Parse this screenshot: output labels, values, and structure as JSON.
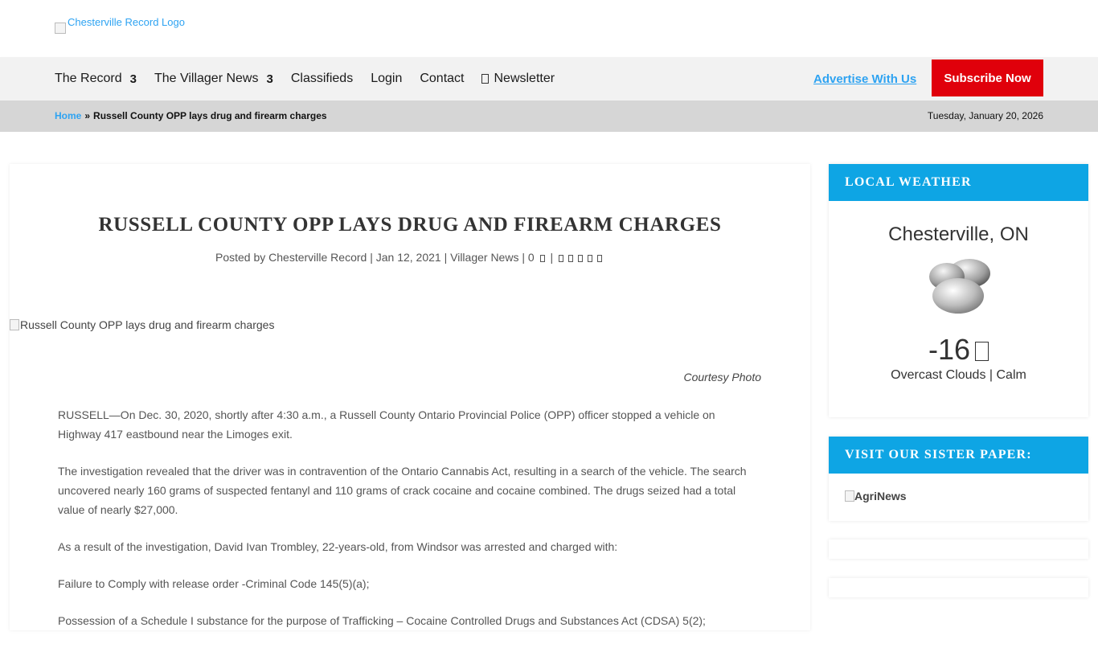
{
  "header": {
    "logo_alt": "Chesterville Record Logo"
  },
  "nav": {
    "items": [
      {
        "label": "The Record",
        "caret": "3"
      },
      {
        "label": "The Villager News",
        "caret": "3"
      },
      {
        "label": "Classifieds"
      },
      {
        "label": "Login"
      },
      {
        "label": "Contact"
      },
      {
        "label": "Newsletter",
        "icon": "envelope-icon"
      }
    ],
    "advertise_label": "Advertise With Us",
    "subscribe_label": "Subscribe Now",
    "subscribe_color": "#e0000b",
    "link_color": "#2ea3f2"
  },
  "breadcrumb": {
    "home": "Home",
    "separator": "»",
    "current": "Russell County OPP lays drug and firearm charges",
    "date": "Tuesday, January 20, 2026"
  },
  "article": {
    "title": "RUSSELL COUNTY OPP LAYS DRUG AND FIREARM CHARGES",
    "meta": {
      "posted_by_prefix": "Posted by",
      "author": "Chesterville Record",
      "date": "Jan 12, 2021",
      "category": "Villager News",
      "comments": "0",
      "rating_icon": "star-icon"
    },
    "image_alt": "Russell County OPP lays drug and firearm charges",
    "caption": "Courtesy Photo",
    "paragraphs": [
      "RUSSELL—On Dec. 30, 2020, shortly after 4:30 a.m., a Russell County Ontario Provincial Police (OPP) officer stopped a vehicle on Highway 417 eastbound near the Limoges exit.",
      "The investigation revealed that the driver was in contravention of the Ontario Cannabis Act, resulting in a search of the vehicle. The search uncovered nearly 160 grams of suspected fentanyl and 110 grams of crack cocaine and cocaine combined. The drugs seized had a total value of nearly $27,000.",
      "As a result of the investigation, David Ivan Trombley, 22-years-old, from Windsor was arrested and charged with:",
      "Failure to Comply with release order -Criminal Code 145(5)(a);",
      "Possession of a Schedule I substance for the purpose of Trafficking – Cocaine Controlled Drugs and Substances Act (CDSA) 5(2);"
    ]
  },
  "sidebar": {
    "weather": {
      "heading": "LOCAL WEATHER",
      "city": "Chesterville, ON",
      "icon": "cloud-icon",
      "temp": "-16",
      "condition": "Overcast Clouds | Calm"
    },
    "sister": {
      "heading": "VISIT OUR SISTER PAPER:",
      "image_alt": "AgriNews"
    },
    "accent_color": "#0ea5e4"
  }
}
